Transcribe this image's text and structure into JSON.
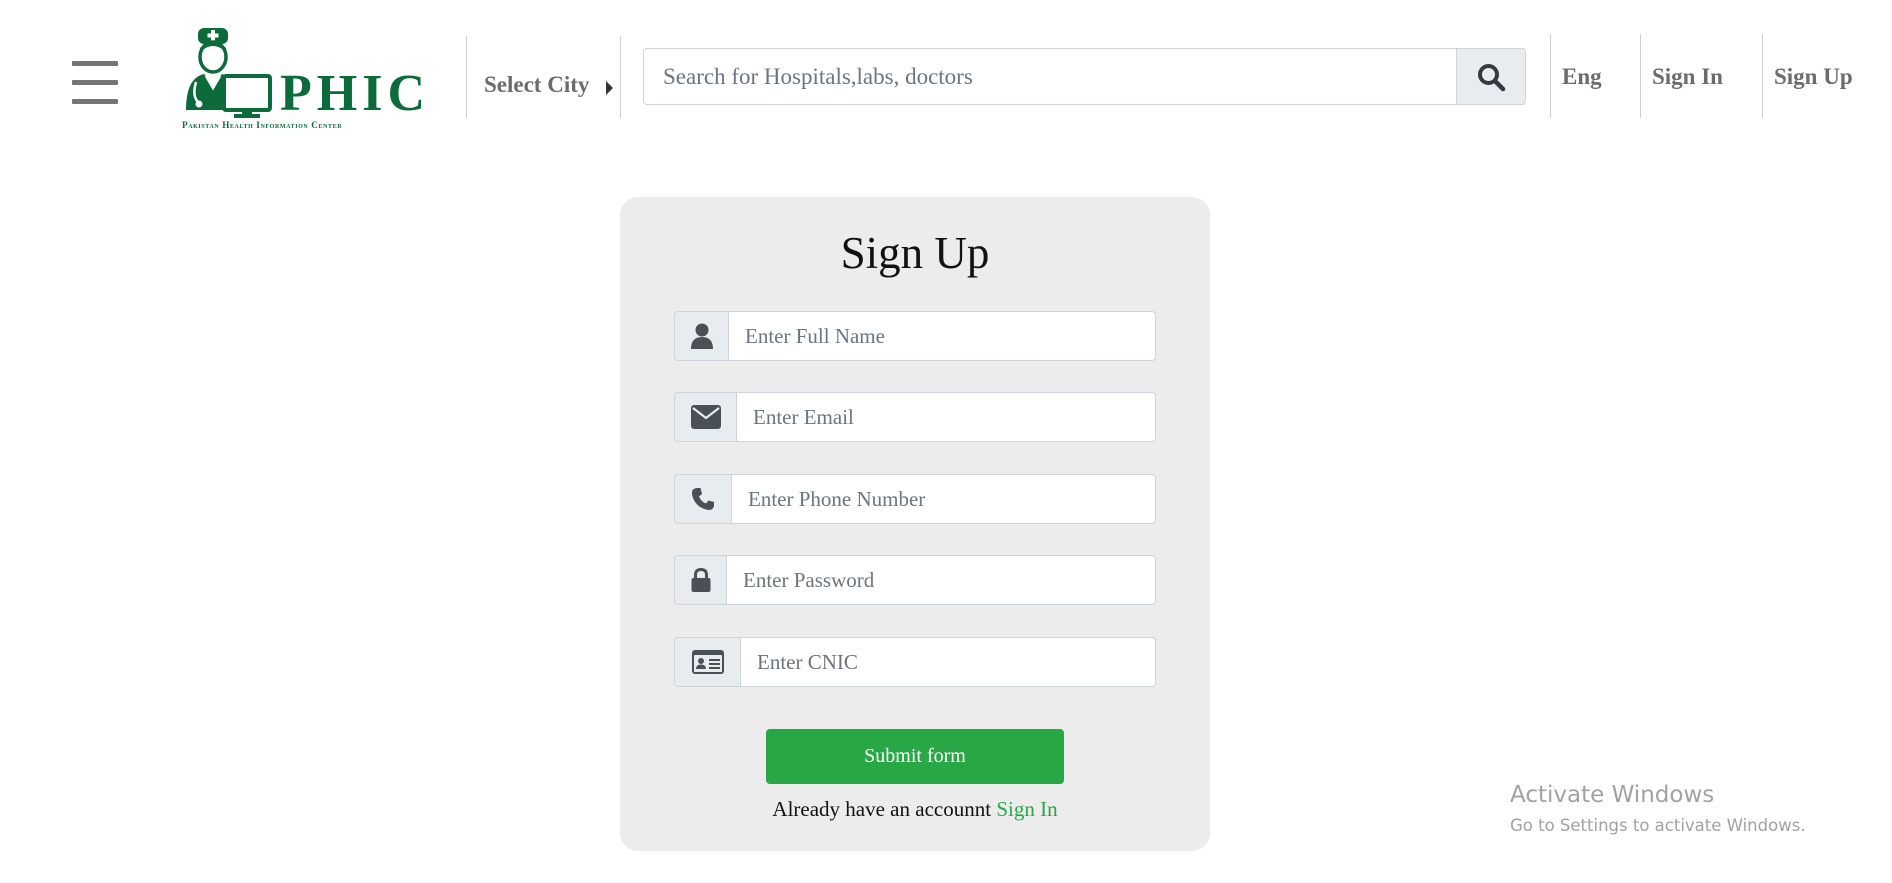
{
  "header": {
    "logo_text": "PHIC",
    "logo_tagline": "Pakistan Health Information Center",
    "city_label": "Select City",
    "search": {
      "placeholder": "Search for Hospitals,labs, doctors"
    },
    "nav": {
      "language": "Eng",
      "sign_in": "Sign In",
      "sign_up": "Sign Up"
    },
    "icons": [
      "menu-icon",
      "doctor-logo-icon",
      "caret-right-icon",
      "search-icon"
    ]
  },
  "form": {
    "title": "Sign Up",
    "fields": [
      {
        "icon": "user-icon",
        "placeholder": "Enter Full Name"
      },
      {
        "icon": "envelope-icon",
        "placeholder": "Enter Email"
      },
      {
        "icon": "phone-icon",
        "placeholder": "Enter Phone Number"
      },
      {
        "icon": "lock-icon",
        "placeholder": "Enter Password"
      },
      {
        "icon": "id-card-icon",
        "placeholder": "Enter CNIC"
      }
    ],
    "submit_label": "Submit form",
    "footer_text": "Already have an accounnt",
    "footer_link": "Sign In"
  },
  "watermark": {
    "title": "Activate Windows",
    "subtitle": "Go to Settings to activate Windows."
  },
  "colors": {
    "brand_green": "#0b6b3a",
    "submit_green": "#28a745",
    "card_bg": "#ebeceb",
    "addon_bg": "#e9ecef",
    "nav_text": "#6c6c6c"
  }
}
